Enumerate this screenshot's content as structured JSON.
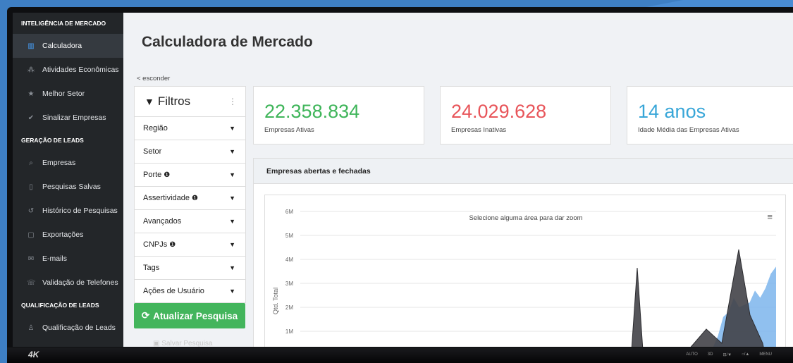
{
  "sidebar": {
    "sections": [
      {
        "title": "INTELIGÊNCIA DE MERCADO",
        "items": [
          {
            "label": "Calculadora",
            "icon": "bar-chart-icon"
          },
          {
            "label": "Atividades Econômicas",
            "icon": "sitemap-icon"
          },
          {
            "label": "Melhor Setor",
            "icon": "star-icon"
          },
          {
            "label": "Sinalizar Empresas",
            "icon": "check-icon"
          }
        ]
      },
      {
        "title": "GERAÇÃO DE LEADS",
        "items": [
          {
            "label": "Empresas",
            "icon": "search-icon"
          },
          {
            "label": "Pesquisas Salvas",
            "icon": "bookmark-icon"
          },
          {
            "label": "Histórico de Pesquisas",
            "icon": "history-icon"
          },
          {
            "label": "Exportações",
            "icon": "file-icon"
          },
          {
            "label": "E-mails",
            "icon": "envelope-icon"
          },
          {
            "label": "Validação de Telefones",
            "icon": "phone-icon"
          }
        ]
      },
      {
        "title": "QUALIFICAÇÃO DE LEADS",
        "items": [
          {
            "label": "Qualificação de Leads",
            "icon": "user-icon"
          }
        ]
      }
    ]
  },
  "page": {
    "title": "Calculadora de Mercado",
    "hide_link": "< esconder"
  },
  "filters": {
    "title": "Filtros",
    "rows": [
      {
        "label": "Região",
        "info": false
      },
      {
        "label": "Setor",
        "info": false
      },
      {
        "label": "Porte",
        "info": true
      },
      {
        "label": "Assertividade",
        "info": true
      },
      {
        "label": "Avançados",
        "info": false
      },
      {
        "label": "CNPJs",
        "info": true
      },
      {
        "label": "Tags",
        "info": false
      },
      {
        "label": "Ações de Usuário",
        "info": false
      }
    ],
    "update_button": "Atualizar Pesquisa",
    "save_button": "Salvar Pesquisa"
  },
  "stats": [
    {
      "value": "22.358.834",
      "label": "Empresas Ativas",
      "color": "#3fb55a"
    },
    {
      "value": "24.029.628",
      "label": "Empresas Inativas",
      "color": "#e8555a"
    },
    {
      "value": "14 anos",
      "label": "Idade Média das Empresas Ativas",
      "color": "#38a6d8"
    }
  ],
  "chart_panel": {
    "title": "Empresas abertas e fechadas"
  },
  "chart_data": {
    "type": "area",
    "title": "Selecione alguma área para dar zoom",
    "ylabel": "Qtd. Total",
    "ylim": [
      0,
      6000000
    ],
    "yticks": [
      "1M",
      "2M",
      "3M",
      "4M",
      "5M",
      "6M"
    ],
    "series": [
      {
        "color": "#7cb5ec",
        "values": [
          0,
          0,
          0,
          0,
          0,
          0,
          0,
          0,
          0,
          0,
          0,
          0,
          0,
          0,
          0,
          0,
          0,
          0,
          0,
          0,
          0,
          0,
          0,
          0,
          0,
          0,
          0,
          0,
          0,
          0,
          0,
          0,
          0,
          0,
          0,
          0,
          0,
          0,
          0,
          0,
          0,
          0,
          0,
          0,
          0,
          0,
          0,
          0,
          0,
          0,
          0,
          0,
          0,
          0,
          0,
          0,
          0,
          0,
          0,
          0,
          0,
          0,
          0,
          0,
          0,
          0,
          0,
          100000,
          0,
          0,
          0,
          0,
          0,
          0,
          0,
          0,
          0,
          0,
          300000,
          800000,
          1600000,
          1800000,
          2400000,
          2000000,
          2100000,
          2200000,
          2700000,
          2400000,
          2800000,
          3400000,
          3700000
        ]
      },
      {
        "color": "#434348",
        "values": [
          0,
          0,
          0,
          0,
          0,
          0,
          0,
          0,
          0,
          0,
          0,
          0,
          0,
          0,
          0,
          0,
          0,
          0,
          0,
          0,
          0,
          0,
          0,
          0,
          0,
          0,
          0,
          0,
          0,
          0,
          0,
          0,
          0,
          0,
          0,
          0,
          0,
          0,
          0,
          0,
          0,
          0,
          0,
          0,
          0,
          0,
          0,
          0,
          0,
          0,
          0,
          0,
          0,
          0,
          0,
          0,
          0,
          0,
          0,
          0,
          0,
          0,
          0,
          0,
          0,
          0,
          0,
          0,
          0,
          0,
          0,
          0,
          0,
          0,
          0,
          0,
          0,
          0,
          0,
          0,
          0,
          0,
          0,
          0,
          0,
          0,
          0,
          0,
          0,
          0,
          0
        ]
      }
    ]
  },
  "tv": {
    "brand": "4K",
    "buttons": [
      "AUTO",
      "3D",
      "⊟/▼",
      "○/▲",
      "MENU"
    ]
  }
}
